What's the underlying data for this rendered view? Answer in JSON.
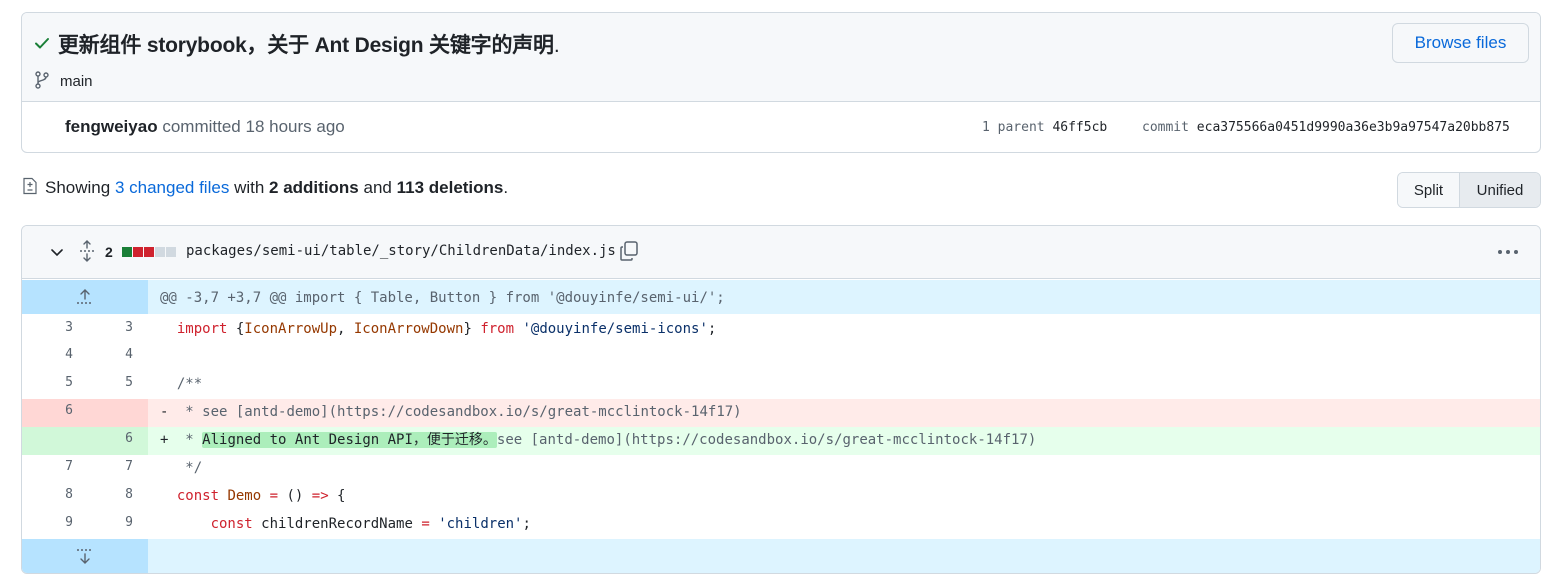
{
  "commit": {
    "title_bold": "更新组件 storybook，关于 Ant Design 关键字的声明",
    "title_tail": ".",
    "branch": "main",
    "browse_label": "Browse files",
    "author": "fengweiyao",
    "action": "committed",
    "time": "18 hours ago",
    "parent_label": "1 parent",
    "parent_sha": "46ff5cb",
    "commit_label": "commit",
    "commit_sha": "eca375566a0451d9990a36e3b9a97547a20bb875"
  },
  "summary": {
    "prefix": "Showing",
    "changed_files": "3 changed files",
    "with": "with",
    "additions": "2 additions",
    "and": "and",
    "deletions": "113 deletions",
    "suffix": "."
  },
  "view_toggle": {
    "split": "Split",
    "unified": "Unified",
    "selected": "Unified"
  },
  "file": {
    "change_count": "2",
    "diffstat_colors": [
      "#1a7f37",
      "#cf222e",
      "#cf222e",
      "#d1d9e0",
      "#d1d9e0"
    ],
    "path": "packages/semi-ui/table/_story/ChildrenData/index.js"
  },
  "diff": {
    "hunk_header": "@@ -3,7 +3,7 @@ import { Table, Button } from '@douyinfe/semi-ui/';",
    "rows": [
      {
        "old": "3",
        "new": "3",
        "type": "ctx",
        "kw1": "import",
        "p1": " {",
        "fn1": "IconArrowUp",
        "p2": ", ",
        "fn2": "IconArrowDown",
        "p3": "} ",
        "kw2": "from",
        "p4": " ",
        "str": "'@douyinfe/semi-icons'",
        "p5": ";"
      },
      {
        "old": "4",
        "new": "4",
        "type": "ctx"
      },
      {
        "old": "5",
        "new": "5",
        "type": "ctx",
        "cm": "/**"
      },
      {
        "old": "6",
        "new": "",
        "type": "del",
        "sign": "-",
        "cm": " * see [antd-demo](https://codesandbox.io/s/great-mcclintock-14f17)"
      },
      {
        "old": "",
        "new": "6",
        "type": "add",
        "sign": "+",
        "cm_pre": " * ",
        "hl": "Aligned to Ant Design API，便于迁移。",
        "cm_post": "see [antd-demo](https://codesandbox.io/s/great-mcclintock-14f17)"
      },
      {
        "old": "7",
        "new": "7",
        "type": "ctx",
        "cm": " */"
      },
      {
        "old": "8",
        "new": "8",
        "type": "ctx",
        "kw1": "const",
        "p1": " ",
        "fn1": "Demo",
        "p2": " ",
        "kw2": "=",
        "p3": " () ",
        "kw3": "=>",
        "p4": " {"
      },
      {
        "old": "9",
        "new": "9",
        "type": "ctx",
        "kw1": "const",
        "p1": " childrenRecordName ",
        "kw2": "=",
        "p2": " ",
        "str": "'children'",
        "p3": ";"
      }
    ]
  }
}
